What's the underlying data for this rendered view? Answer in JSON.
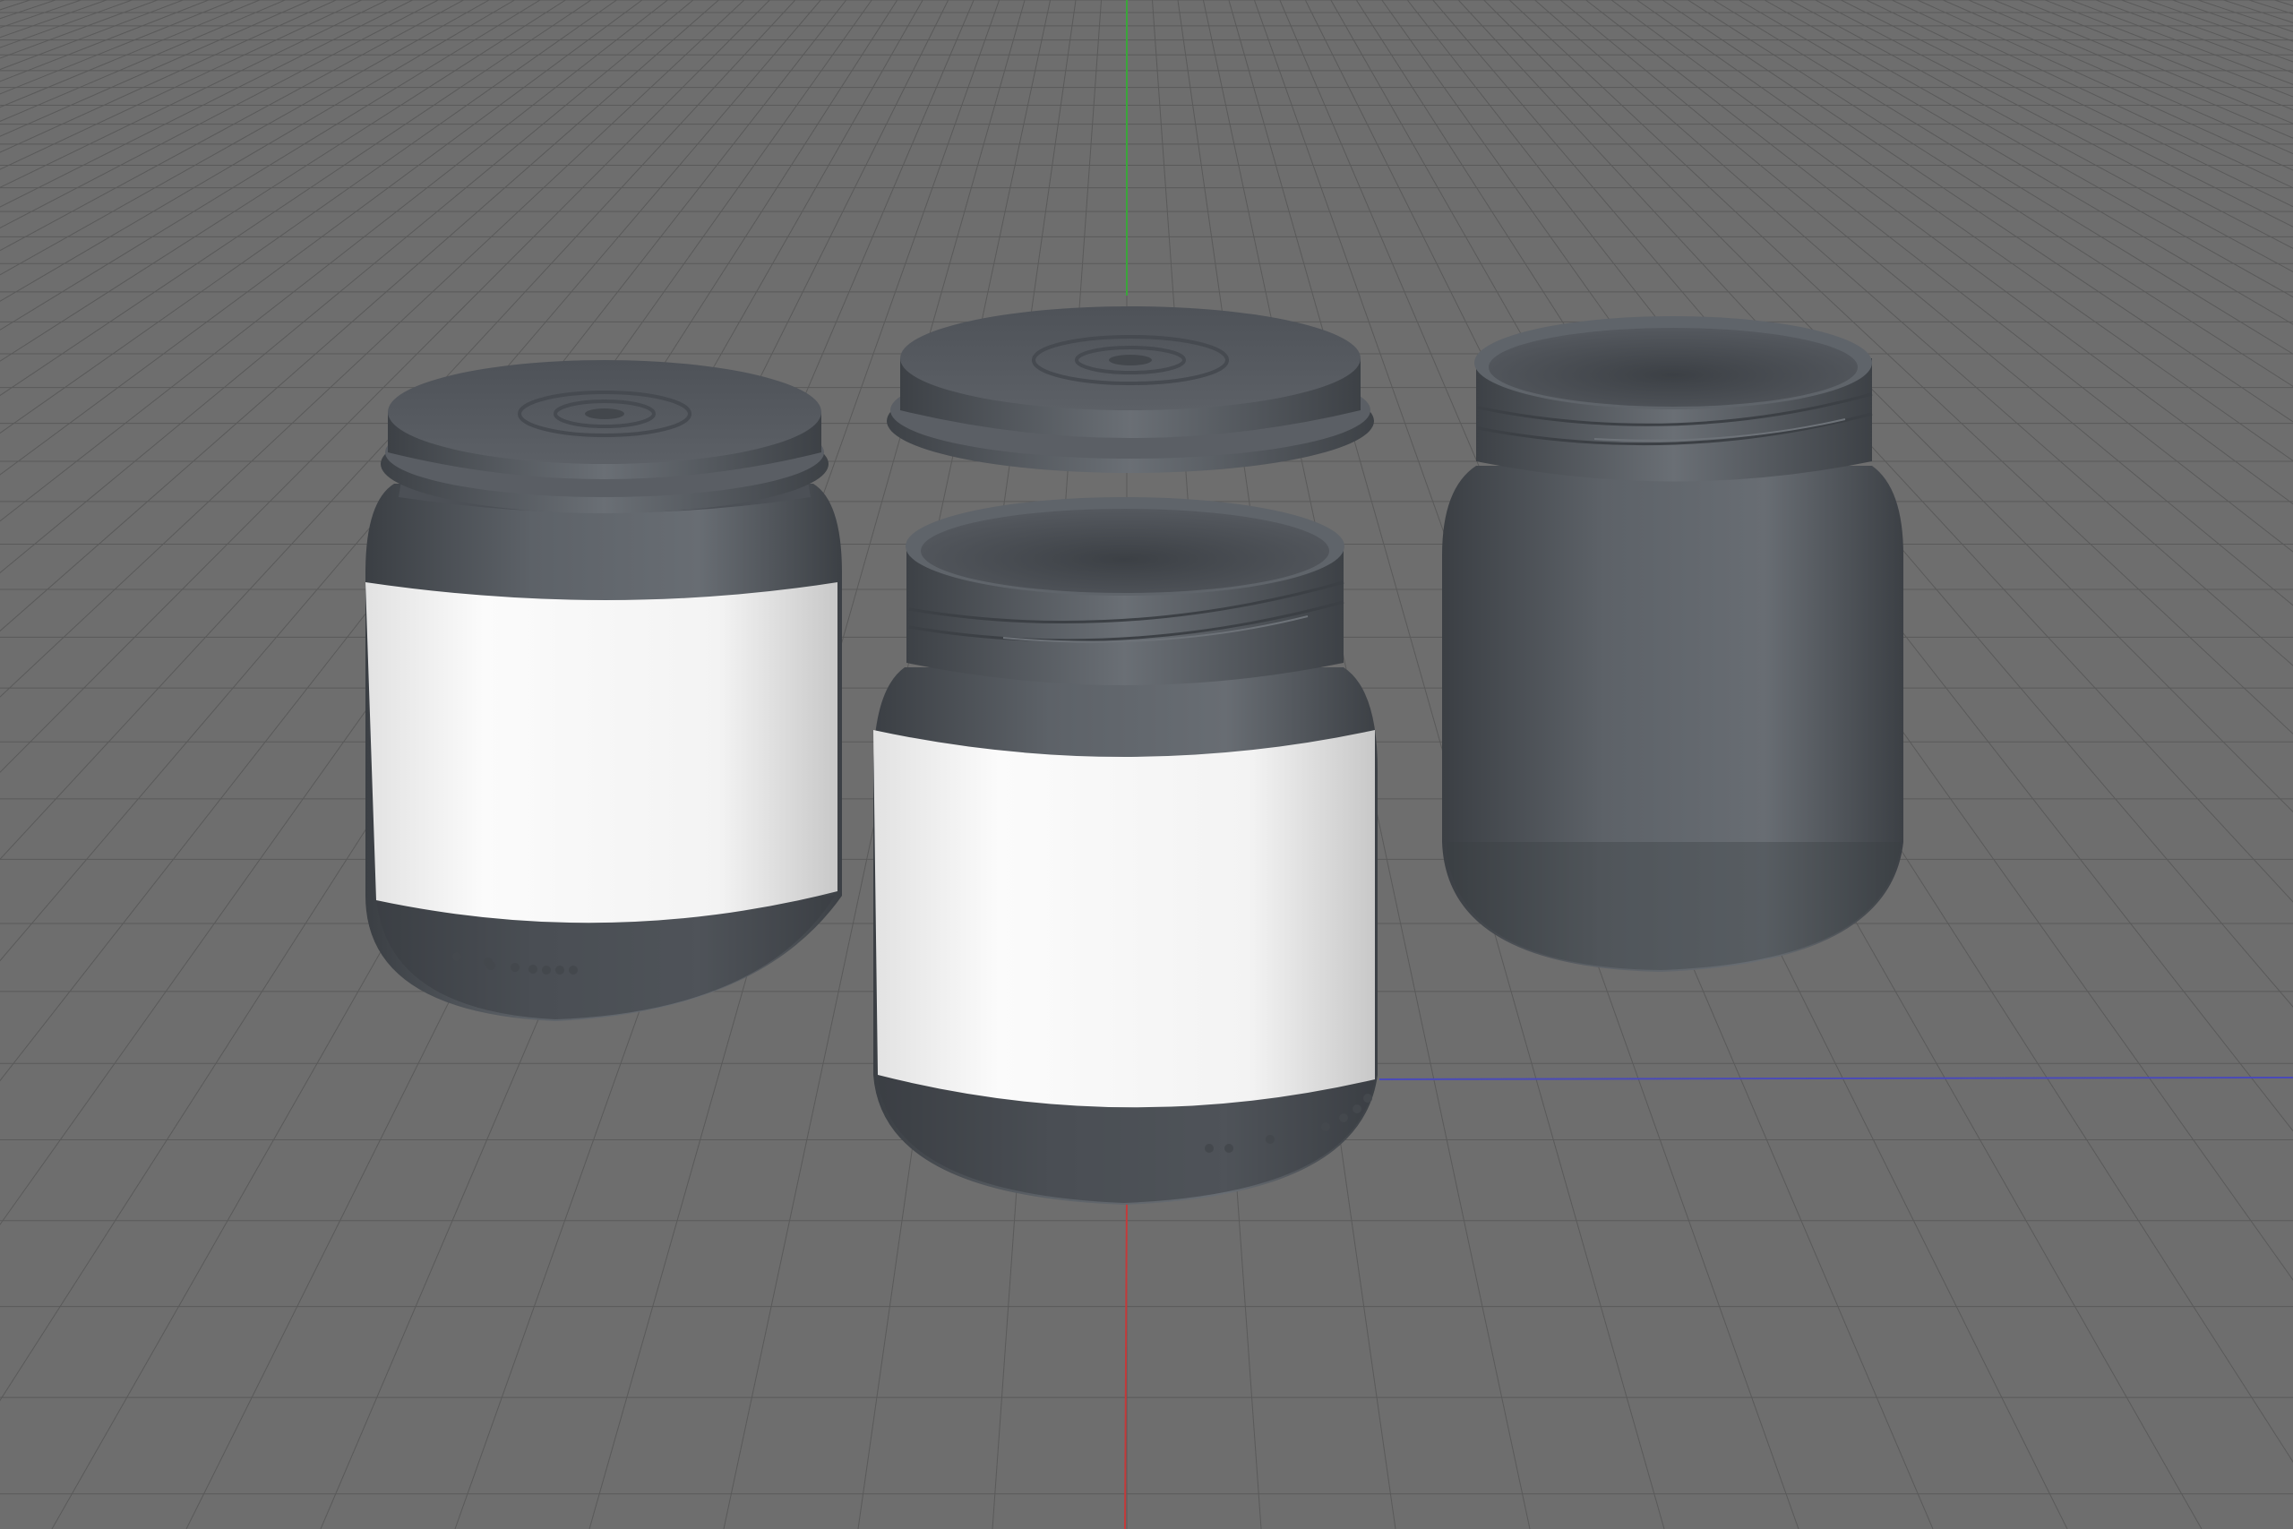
{
  "viewport": {
    "background": "#6e6e6e",
    "grid_color": "#5a5a5a",
    "grid_minor_color": "#666666",
    "axis_y_color": "#3aa63a",
    "axis_x_color": "#c43a3a",
    "axis_z_color": "#4a4ab8"
  },
  "scene": {
    "objects": [
      {
        "name": "jar-with-lid-left",
        "label_color": "#f4f4f4",
        "body_color": "#53575d"
      },
      {
        "name": "lid-floating-center",
        "body_color": "#53575d"
      },
      {
        "name": "jar-open-center",
        "label_color": "#f4f4f4",
        "body_color": "#53575d"
      },
      {
        "name": "jar-open-right",
        "body_color": "#53575d"
      }
    ]
  }
}
